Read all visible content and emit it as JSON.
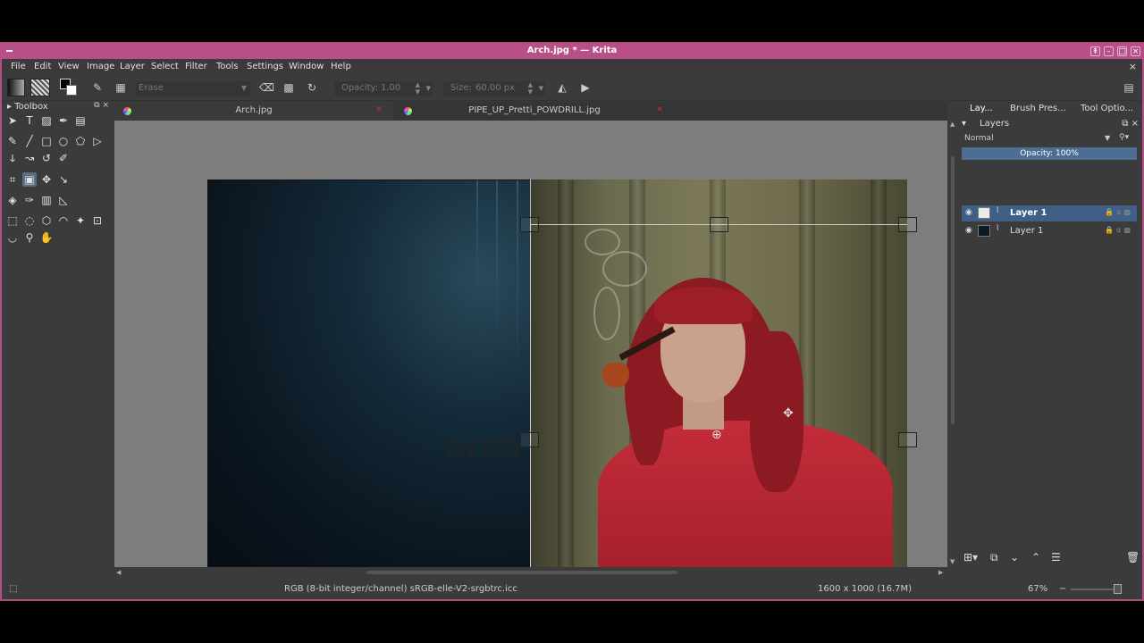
{
  "window": {
    "title": "Arch.jpg * — Krita"
  },
  "menu": [
    "File",
    "Edit",
    "View",
    "Image",
    "Layer",
    "Select",
    "Filter",
    "Tools",
    "Settings",
    "Window",
    "Help"
  ],
  "tool_options": {
    "preset": "Erase",
    "opacity_label": "Opacity:",
    "opacity_value": "1.00",
    "size_label": "Size:",
    "size_value": "60.00 px"
  },
  "toolbox": {
    "title": "Toolbox"
  },
  "documents": {
    "tabs": [
      {
        "name": "Arch.jpg"
      },
      {
        "name": "PIPE_UP_Pretti_POWDRILL.jpg"
      }
    ],
    "left_image_text": "arch"
  },
  "dock": {
    "tabs": [
      "Lay...",
      "Brush Pres...",
      "Tool Optio..."
    ],
    "layers_title": "Layers",
    "blend_mode": "Normal",
    "opacity": "Opacity:  100%",
    "layers": [
      {
        "name": "Layer 1",
        "selected": true
      },
      {
        "name": "Layer 1",
        "selected": false
      }
    ]
  },
  "status": {
    "color_profile": "RGB (8-bit integer/channel)  sRGB-elle-V2-srgbtrc.icc",
    "image_size": "1600 x 1000 (16.7M)",
    "zoom": "67%"
  },
  "colors": {
    "titlebar": "#b94f87",
    "selection": "#4c6d94",
    "background": "#3b3b3b"
  }
}
